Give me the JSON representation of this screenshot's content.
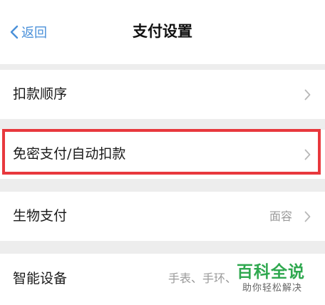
{
  "nav": {
    "back_label": "返回",
    "title": "支付设置"
  },
  "rows": [
    {
      "label": "扣款顺序",
      "value": ""
    },
    {
      "label": "免密支付/自动扣款",
      "value": ""
    },
    {
      "label": "生物支付",
      "value": "面容"
    },
    {
      "label": "智能设备",
      "value": "手表、手环、"
    }
  ],
  "watermark": {
    "title": "百科全说",
    "subtitle": "助你轻松解决"
  },
  "colors": {
    "accent": "#4a90d9",
    "highlight": "#e8383d",
    "background": "#ededed",
    "watermark": "#2fa84f"
  },
  "icons": {
    "back": "chevron-left-icon",
    "row_arrow": "chevron-right-icon"
  }
}
